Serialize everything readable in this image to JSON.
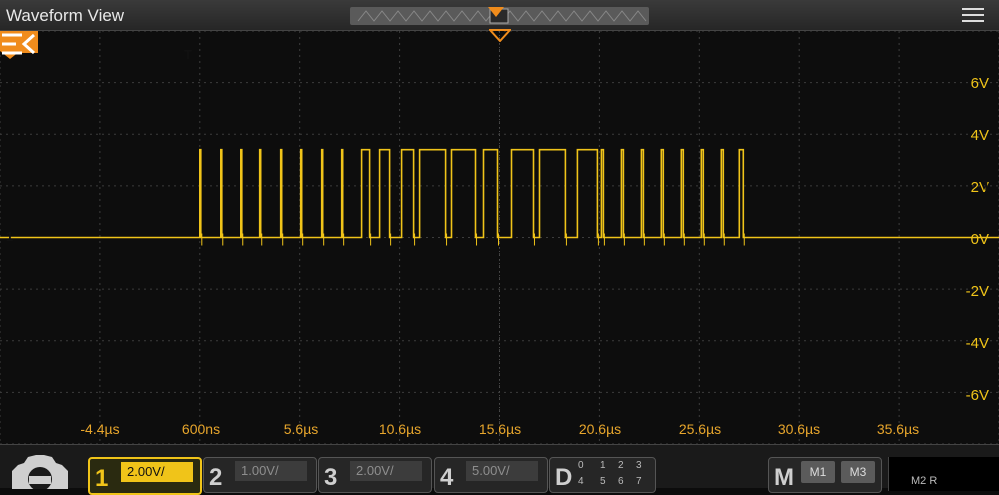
{
  "window": {
    "title": "Waveform View"
  },
  "chart_data": {
    "type": "line",
    "title": "",
    "xlabel": "",
    "ylabel": "",
    "x_ticks": [
      "-4.4µs",
      "600ns",
      "5.6µs",
      "10.6µs",
      "15.6µs",
      "20.6µs",
      "25.6µs",
      "30.6µs",
      "35.6µs"
    ],
    "y_ticks": [
      "6V",
      "4V",
      "2V",
      "0V",
      "-2V",
      "-4V",
      "-6V"
    ],
    "xlim_us": [
      -9.4,
      40.6
    ],
    "ylim_v": [
      -8,
      8
    ],
    "grid": true,
    "series": [
      {
        "name": "1",
        "color": "#f0c419",
        "high_level_v": 3.4,
        "low_level_v": 0,
        "pulses_us": [
          [
            0.6,
            0.65
          ],
          [
            1.65,
            1.7
          ],
          [
            2.65,
            2.7
          ],
          [
            3.6,
            3.65
          ],
          [
            4.65,
            4.7
          ],
          [
            5.65,
            5.7
          ],
          [
            6.7,
            6.75
          ],
          [
            7.7,
            7.75
          ],
          [
            8.7,
            9.1
          ],
          [
            9.6,
            10.1
          ],
          [
            10.7,
            11.3
          ],
          [
            11.6,
            12.9
          ],
          [
            13.2,
            14.4
          ],
          [
            14.8,
            15.5
          ],
          [
            16.2,
            17.3
          ],
          [
            17.6,
            18.9
          ],
          [
            19.5,
            20.5
          ],
          [
            20.7,
            20.8
          ],
          [
            21.7,
            21.8
          ],
          [
            22.7,
            22.8
          ],
          [
            23.7,
            23.8
          ],
          [
            24.7,
            24.8
          ],
          [
            25.7,
            25.8
          ],
          [
            26.7,
            26.8
          ],
          [
            27.6,
            27.8
          ]
        ]
      }
    ]
  },
  "markers": {
    "channel1_ground": "1",
    "trigger_level": "T",
    "trigger_time": "T"
  },
  "channels": [
    {
      "num": "1",
      "scale": "2.00V/"
    },
    {
      "num": "2",
      "scale": "1.00V/"
    },
    {
      "num": "3",
      "scale": "2.00V/"
    },
    {
      "num": "4",
      "scale": "5.00V/"
    }
  ],
  "digital": {
    "label": "D",
    "bits_top": [
      "0",
      "1",
      "2",
      "3"
    ],
    "bits_bottom": [
      "4",
      "5",
      "6",
      "7"
    ]
  },
  "math": {
    "label": "M",
    "tabs": [
      "M1",
      "M3"
    ]
  },
  "extra": {
    "text": "M2  R"
  },
  "icons": {
    "menu": "hamburger-menu-icon",
    "settings": "gear-icon",
    "collapse": "collapse-panel-icon"
  }
}
